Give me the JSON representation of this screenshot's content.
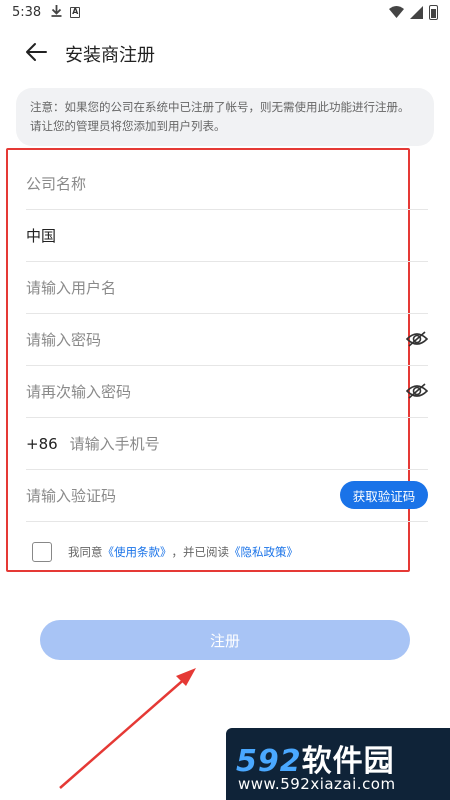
{
  "status_bar": {
    "time": "5:38",
    "download_icon": "download-icon",
    "app_icon_letter": "A"
  },
  "header": {
    "title": "安装商注册",
    "back_icon": "arrow-left-icon"
  },
  "notice": {
    "text": "注意：如果您的公司在系统中已注册了帐号，则无需使用此功能进行注册。请让您的管理员将您添加到用户列表。"
  },
  "form": {
    "company_placeholder": "公司名称",
    "country_value": "中国",
    "username_placeholder": "请输入用户名",
    "password_placeholder": "请输入密码",
    "password_confirm_placeholder": "请再次输入密码",
    "phone_prefix": "+86",
    "phone_placeholder": "请输入手机号",
    "code_placeholder": "请输入验证码",
    "get_code_label": "获取验证码",
    "agree_prefix": "我同意",
    "terms_link": "《使用条款》",
    "agree_middle": "，并已阅读",
    "privacy_link": "《隐私政策》",
    "eye_icon": "eye-off-icon"
  },
  "register_button": {
    "label": "注册"
  },
  "watermark": {
    "brand_num": "592",
    "brand_cn": "软件园",
    "url": "www.592xiazai.com"
  },
  "colors": {
    "accent": "#1a73e8",
    "register_disabled": "#a8c4f5",
    "highlight_border": "#e53935",
    "notice_bg": "#f1f2f4"
  }
}
